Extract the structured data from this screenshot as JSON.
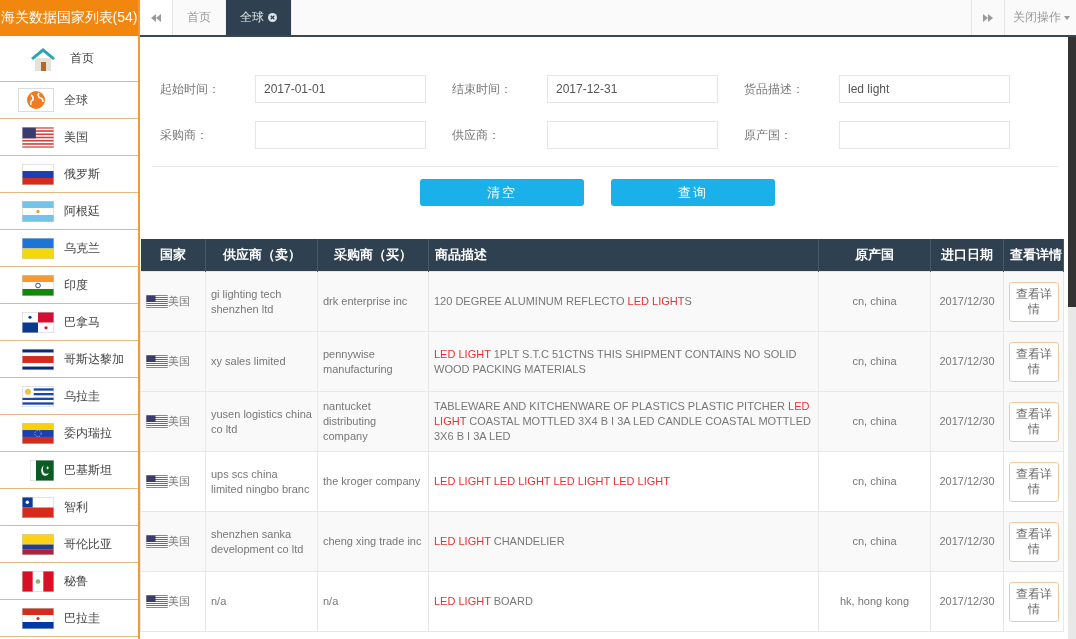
{
  "sidebar": {
    "title": "海关数据国家列表(54)",
    "items": [
      {
        "label": "首页",
        "kind": "home"
      },
      {
        "label": "全球",
        "kind": "globe"
      },
      {
        "label": "美国",
        "kind": "us"
      },
      {
        "label": "俄罗斯",
        "kind": "ru"
      },
      {
        "label": "阿根廷",
        "kind": "ar"
      },
      {
        "label": "乌克兰",
        "kind": "ua"
      },
      {
        "label": "印度",
        "kind": "in"
      },
      {
        "label": "巴拿马",
        "kind": "pa"
      },
      {
        "label": "哥斯达黎加",
        "kind": "cr"
      },
      {
        "label": "乌拉圭",
        "kind": "uy"
      },
      {
        "label": "委内瑞拉",
        "kind": "ve"
      },
      {
        "label": "巴基斯坦",
        "kind": "pk"
      },
      {
        "label": "智利",
        "kind": "cl"
      },
      {
        "label": "哥伦比亚",
        "kind": "co"
      },
      {
        "label": "秘鲁",
        "kind": "pe"
      },
      {
        "label": "巴拉圭",
        "kind": "py"
      }
    ]
  },
  "tabs": [
    {
      "label": "首页",
      "selected": false,
      "closable": false
    },
    {
      "label": "全球",
      "selected": true,
      "closable": true
    }
  ],
  "close_menu": "关闭操作",
  "form": {
    "fields": [
      {
        "label": "起始时间：",
        "value": "2017-01-01"
      },
      {
        "label": "结束时间：",
        "value": "2017-12-31"
      },
      {
        "label": "货品描述：",
        "value": "led light"
      },
      {
        "label": "采购商："
      },
      {
        "label": "供应商："
      },
      {
        "label": "原产国："
      }
    ],
    "buttons": [
      "清空",
      "查询"
    ]
  },
  "table": {
    "columns": [
      "国家",
      "供应商（卖）",
      "采购商（买）",
      "商品描述",
      "原产国",
      "进口日期",
      "查看详情"
    ],
    "rows": [
      {
        "kind": "us",
        "country": "美国",
        "supplier": "gi lighting tech shenzhen ltd",
        "buyer": "drk enterprise inc",
        "description": [
          {
            "text": "120 DEGREE ALUMINUM REFLECTO ",
            "highlight": false
          },
          {
            "text": "LED LIGHT",
            "highlight": true
          },
          {
            "text": "S",
            "highlight": false
          }
        ],
        "origin": "cn, china",
        "date": "2017/12/30",
        "action": "查看详情"
      },
      {
        "kind": "us",
        "country": "美国",
        "supplier": "xy sales limited",
        "buyer": "pennywise manufacturing",
        "description": [
          {
            "text": "LED LIGHT",
            "highlight": true
          },
          {
            "text": " 1PLT S.T.C 51CTNS THIS SHIPMENT CONTAINS NO SOLID WOOD PACKING MATERIALS",
            "highlight": false
          }
        ],
        "origin": "cn, china",
        "date": "2017/12/30",
        "action": "查看详情"
      },
      {
        "kind": "us",
        "country": "美国",
        "supplier": "yusen logistics china co ltd",
        "buyer": "nantucket distributing company",
        "description": [
          {
            "text": "TABLEWARE AND KITCHENWARE OF PLASTICS PLASTIC PITCHER ",
            "highlight": false
          },
          {
            "text": "LED LIGHT",
            "highlight": true
          },
          {
            "text": " COASTAL MOTTLED 3X4 B I 3A LED CANDLE COASTAL MOTTLED 3X6 B I 3A LED",
            "highlight": false
          }
        ],
        "origin": "cn, china",
        "date": "2017/12/30",
        "action": "查看详情"
      },
      {
        "kind": "us",
        "country": "美国",
        "supplier": "ups scs china limited ningbo branc",
        "buyer": "the kroger company",
        "description": [
          {
            "text": "LED LIGHT LED LIGHT LED LIGHT LED LIGHT",
            "highlight": true
          }
        ],
        "origin": "cn, china",
        "date": "2017/12/30",
        "action": "查看详情"
      },
      {
        "kind": "us",
        "country": "美国",
        "supplier": "shenzhen sanka development co ltd",
        "buyer": "cheng xing trade inc",
        "description": [
          {
            "text": "LED LIGHT",
            "highlight": true
          },
          {
            "text": " CHANDELIER",
            "highlight": false
          }
        ],
        "origin": "cn, china",
        "date": "2017/12/30",
        "action": "查看详情"
      },
      {
        "kind": "us",
        "country": "美国",
        "supplier": "n/a",
        "buyer": "n/a",
        "description": [
          {
            "text": "LED LIGHT",
            "highlight": true
          },
          {
            "text": " BOARD",
            "highlight": false
          }
        ],
        "origin": "hk, hong kong",
        "date": "2017/12/30",
        "action": "查看详情"
      }
    ]
  }
}
